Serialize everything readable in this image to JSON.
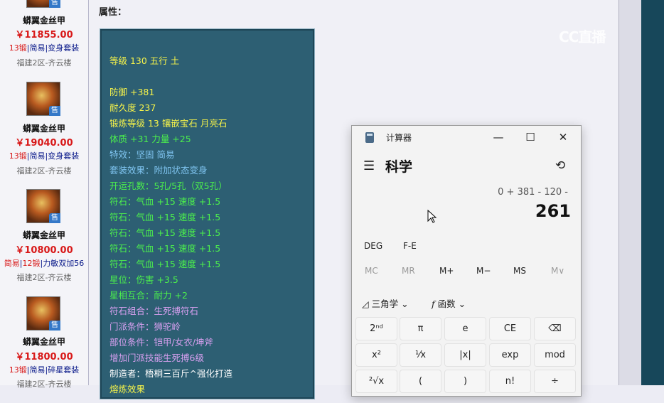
{
  "listing": [
    {
      "name": "蟒翼金丝甲",
      "price": "￥11855.00",
      "tags": [
        "13锻",
        "简易",
        "变身套装"
      ],
      "server": "福建2区-齐云楼",
      "sale": "售"
    },
    {
      "name": "蟒翼金丝甲",
      "price": "￥19040.00",
      "tags": [
        "13锻",
        "简易",
        "变身套装"
      ],
      "server": "福建2区-齐云楼",
      "sale": "售"
    },
    {
      "name": "蟒翼金丝甲",
      "price": "￥10800.00",
      "tags": [
        "简易",
        "12锻",
        "力敏双加56"
      ],
      "server": "福建2区-齐云楼",
      "sale": "售"
    },
    {
      "name": "蟒翼金丝甲",
      "price": "￥11800.00",
      "tags": [
        "13锻",
        "简易",
        "碎星套装"
      ],
      "server": "福建2区-齐云楼",
      "sale": "售"
    }
  ],
  "attributes": {
    "label": "属性：",
    "lines": [
      {
        "text": "等级 130 五行 土",
        "color": "yellow"
      },
      {
        "text": "防御 +381",
        "color": "yellow"
      },
      {
        "text": "耐久度 237",
        "color": "yellow"
      },
      {
        "text": "锻炼等级 13 镶嵌宝石 月亮石",
        "color": "yellow"
      },
      {
        "text": "体质 +31 力量 +25",
        "color": "green"
      },
      {
        "text": "特效：坚固 简易",
        "color": "blue"
      },
      {
        "text": "套装效果：附加状态变身",
        "color": "blue"
      },
      {
        "text": "开运孔数：5孔/5孔（双5孔）",
        "color": "green"
      },
      {
        "text": "符石：气血 +15 速度 +1.5",
        "color": "green"
      },
      {
        "text": "符石：气血 +15 速度 +1.5",
        "color": "green"
      },
      {
        "text": "符石：气血 +15 速度 +1.5",
        "color": "green"
      },
      {
        "text": "符石：气血 +15 速度 +1.5",
        "color": "green"
      },
      {
        "text": "符石：气血 +15 速度 +1.5",
        "color": "green"
      },
      {
        "text": "星位：伤害 +3.5",
        "color": "green"
      },
      {
        "text": "星相互合：耐力 +2",
        "color": "green"
      },
      {
        "text": "符石组合：生死搏符石",
        "color": "purple"
      },
      {
        "text": "门派条件：狮驼岭",
        "color": "purple"
      },
      {
        "text": "部位条件：铠甲/女衣/坤斧",
        "color": "purple"
      },
      {
        "text": "增加门派技能生死搏6级",
        "color": "purple"
      },
      {
        "text": "制造者：梧桐三百斤^强化打造",
        "color": "white"
      },
      {
        "text": "熔炼效果",
        "color": "yellow"
      }
    ]
  },
  "watermark": "CC直播",
  "calculator": {
    "title": "计算器",
    "window_buttons": {
      "minimize": "—",
      "maximize": "☐",
      "close": "✕"
    },
    "mode": "科学",
    "expression": "0 + 381 - 120 -",
    "result": "261",
    "options": [
      "DEG",
      "F-E"
    ],
    "memory": [
      "MC",
      "MR",
      "M+",
      "M−",
      "MS",
      "M∨"
    ],
    "trig_label": "三角学",
    "func_label": "函数",
    "keys_row1": [
      "2ⁿᵈ",
      "π",
      "e",
      "CE",
      "⌫"
    ],
    "keys_row2": [
      "x²",
      "¹⁄x",
      "|x|",
      "exp",
      "mod"
    ],
    "keys_row3": [
      "²√x",
      "(",
      ")",
      "n!",
      "÷"
    ]
  }
}
